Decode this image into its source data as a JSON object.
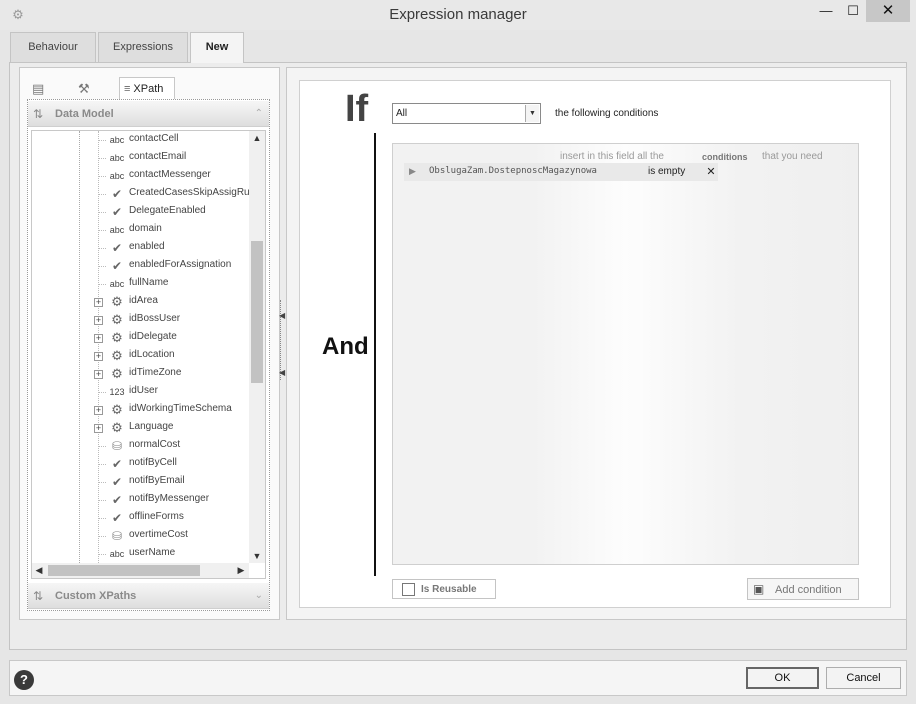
{
  "window": {
    "title": "Expression manager",
    "minimize": "—",
    "maximize": "☐",
    "close": "✕",
    "app_icon": "⚙"
  },
  "tabs": [
    {
      "label": "Behaviour"
    },
    {
      "label": "Expressions"
    },
    {
      "label": "New"
    }
  ],
  "left": {
    "toolbar": {
      "xpath_label": "XPath"
    },
    "data_model_title": "Data Model",
    "custom_xpaths_title": "Custom XPaths",
    "tree": [
      {
        "icon": "abc",
        "label": "contactCell"
      },
      {
        "icon": "abc",
        "label": "contactEmail"
      },
      {
        "icon": "abc",
        "label": "contactMessenger"
      },
      {
        "icon": "check",
        "label": "CreatedCasesSkipAssigRu"
      },
      {
        "icon": "check",
        "label": "DelegateEnabled"
      },
      {
        "icon": "abc",
        "label": "domain"
      },
      {
        "icon": "check",
        "label": "enabled"
      },
      {
        "icon": "check",
        "label": "enabledForAssignation"
      },
      {
        "icon": "abc",
        "label": "fullName"
      },
      {
        "icon": "gear",
        "label": "idArea",
        "expandable": true
      },
      {
        "icon": "gear",
        "label": "idBossUser",
        "expandable": true
      },
      {
        "icon": "gear",
        "label": "idDelegate",
        "expandable": true
      },
      {
        "icon": "gear",
        "label": "idLocation",
        "expandable": true
      },
      {
        "icon": "gear",
        "label": "idTimeZone",
        "expandable": true
      },
      {
        "icon": "123",
        "label": "idUser"
      },
      {
        "icon": "gear",
        "label": "idWorkingTimeSchema",
        "expandable": true
      },
      {
        "icon": "gear",
        "label": "Language",
        "expandable": true
      },
      {
        "icon": "db",
        "label": "normalCost"
      },
      {
        "icon": "check",
        "label": "notifByCell"
      },
      {
        "icon": "check",
        "label": "notifByEmail"
      },
      {
        "icon": "check",
        "label": "notifByMessenger"
      },
      {
        "icon": "check",
        "label": "offlineForms"
      },
      {
        "icon": "db",
        "label": "overtimeCost"
      },
      {
        "icon": "abc",
        "label": "userName"
      }
    ]
  },
  "right": {
    "if_label": "If",
    "and_label": "And",
    "match_select": "All",
    "following_text": "the following conditions",
    "hint_prefix": "insert in this field all the",
    "hint_keyword": "conditions",
    "hint_suffix": "that you need",
    "condition": {
      "field": "ObslugaZam.DostepnoscMagazynowa",
      "operator": "is empty",
      "delete": "✕"
    },
    "is_reusable_label": "Is Reusable",
    "is_reusable_checked": false,
    "add_condition_label": "Add condition"
  },
  "footer": {
    "help": "?",
    "ok_label": "OK",
    "cancel_label": "Cancel"
  }
}
